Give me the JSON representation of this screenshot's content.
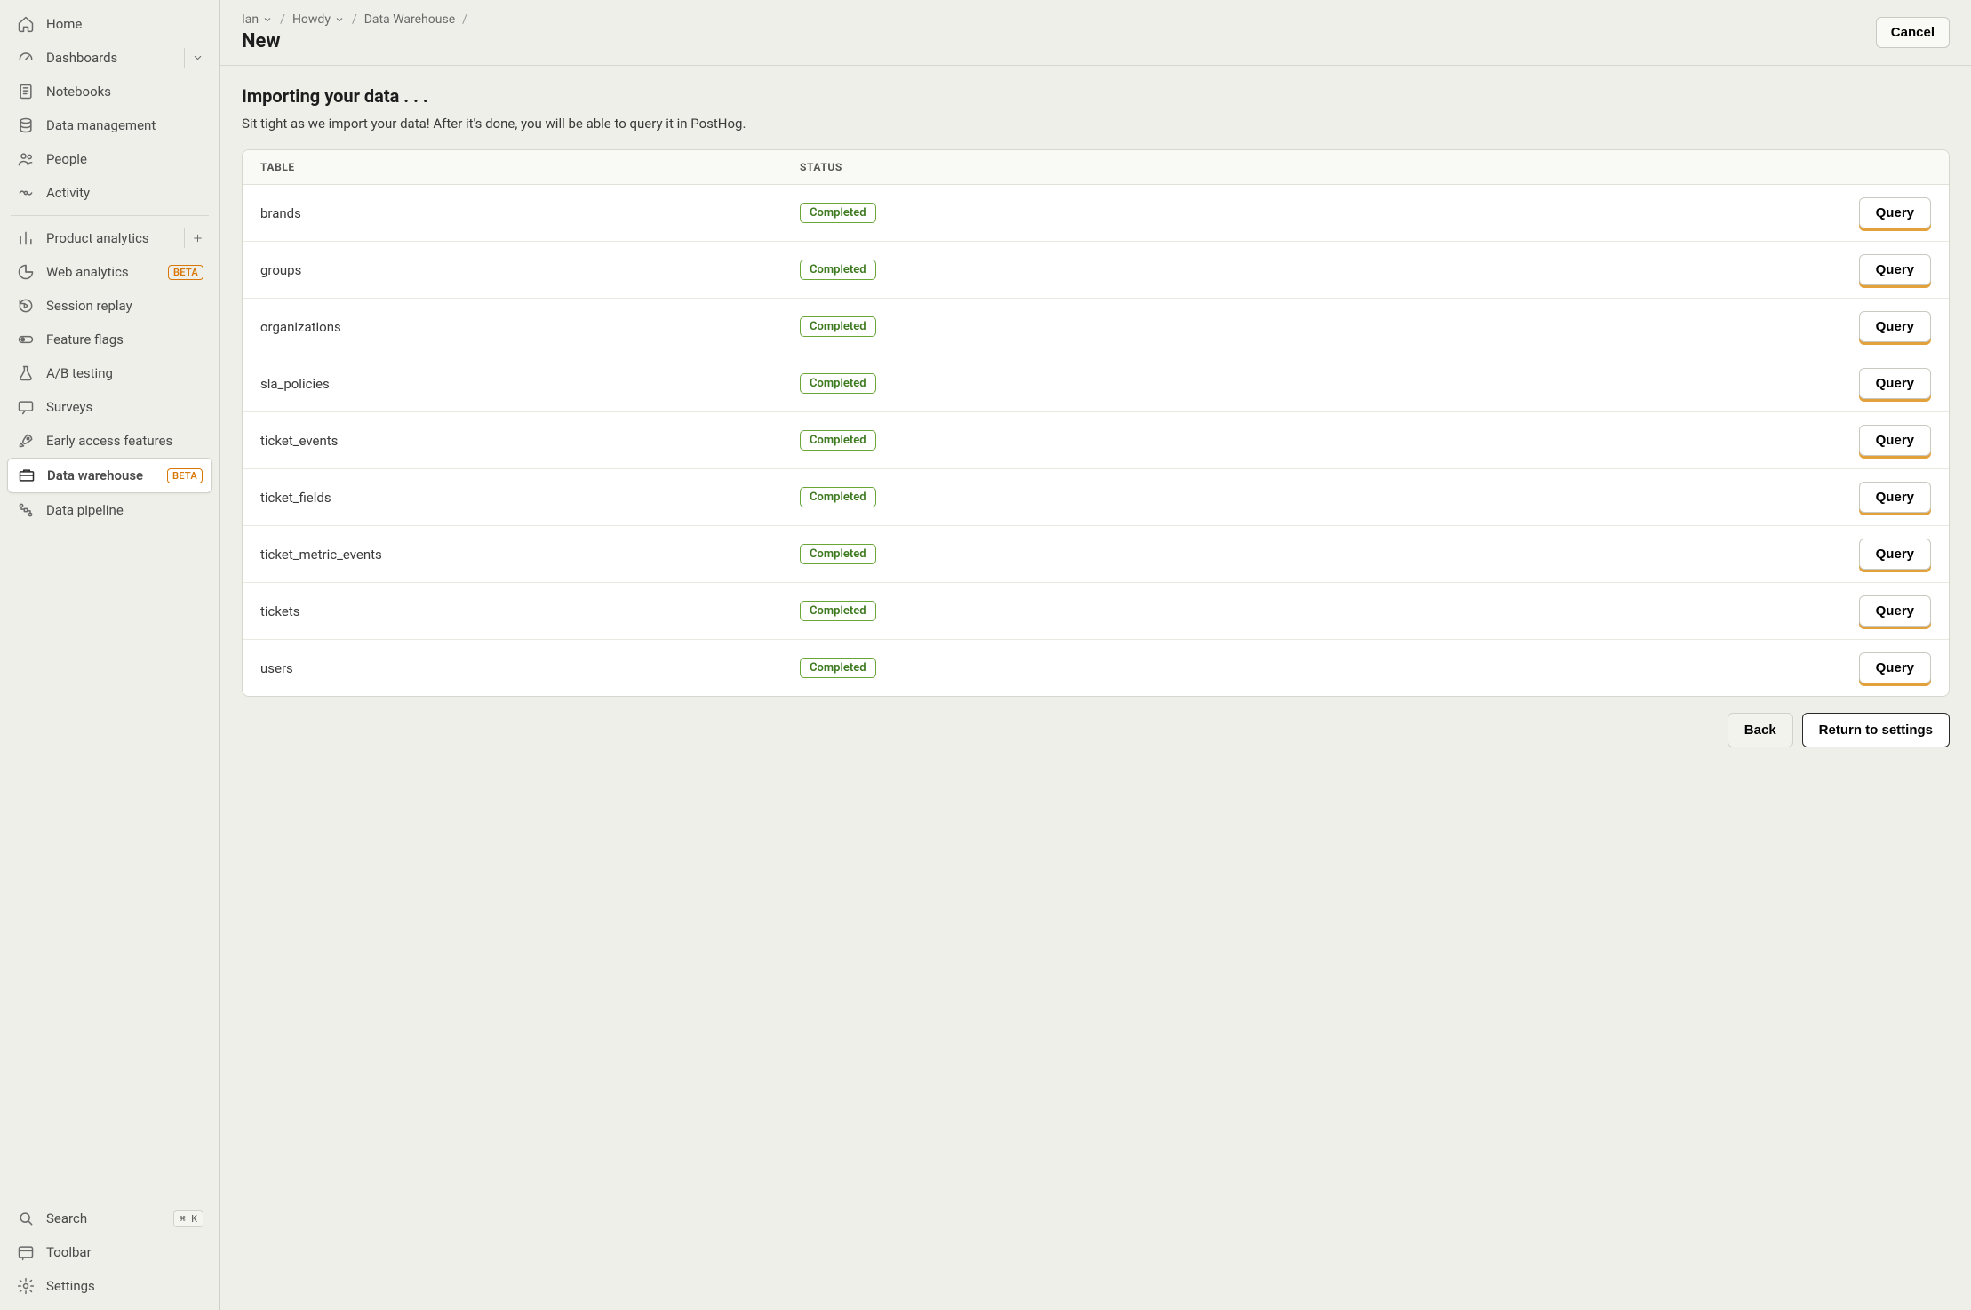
{
  "sidebar": {
    "top": [
      {
        "label": "Home",
        "icon": "home"
      },
      {
        "label": "Dashboards",
        "icon": "gauge",
        "hasExpand": true
      },
      {
        "label": "Notebooks",
        "icon": "notebook"
      },
      {
        "label": "Data management",
        "icon": "database"
      },
      {
        "label": "People",
        "icon": "people"
      },
      {
        "label": "Activity",
        "icon": "activity"
      }
    ],
    "mid": [
      {
        "label": "Product analytics",
        "icon": "bars",
        "hasPlus": true
      },
      {
        "label": "Web analytics",
        "icon": "pie",
        "badge": "BETA"
      },
      {
        "label": "Session replay",
        "icon": "replay"
      },
      {
        "label": "Feature flags",
        "icon": "toggle"
      },
      {
        "label": "A/B testing",
        "icon": "flask"
      },
      {
        "label": "Surveys",
        "icon": "chat"
      },
      {
        "label": "Early access features",
        "icon": "rocket"
      },
      {
        "label": "Data warehouse",
        "icon": "warehouse",
        "badge": "BETA",
        "active": true
      },
      {
        "label": "Data pipeline",
        "icon": "pipeline"
      }
    ],
    "bottom": [
      {
        "label": "Search",
        "icon": "search",
        "kbd": "⌘ K"
      },
      {
        "label": "Toolbar",
        "icon": "toolbar"
      },
      {
        "label": "Settings",
        "icon": "gear"
      }
    ]
  },
  "breadcrumb": {
    "items": [
      "Ian",
      "Howdy",
      "Data Warehouse"
    ],
    "title": "New"
  },
  "topbar": {
    "cancel": "Cancel"
  },
  "page": {
    "heading": "Importing your data . . .",
    "subtext": "Sit tight as we import your data! After it's done, you will be able to query it in PostHog."
  },
  "table": {
    "headers": {
      "table": "TABLE",
      "status": "STATUS"
    },
    "queryLabel": "Query",
    "rows": [
      {
        "name": "brands",
        "status": "Completed"
      },
      {
        "name": "groups",
        "status": "Completed"
      },
      {
        "name": "organizations",
        "status": "Completed"
      },
      {
        "name": "sla_policies",
        "status": "Completed"
      },
      {
        "name": "ticket_events",
        "status": "Completed"
      },
      {
        "name": "ticket_fields",
        "status": "Completed"
      },
      {
        "name": "ticket_metric_events",
        "status": "Completed"
      },
      {
        "name": "tickets",
        "status": "Completed"
      },
      {
        "name": "users",
        "status": "Completed"
      }
    ]
  },
  "footer": {
    "back": "Back",
    "return": "Return to settings"
  }
}
